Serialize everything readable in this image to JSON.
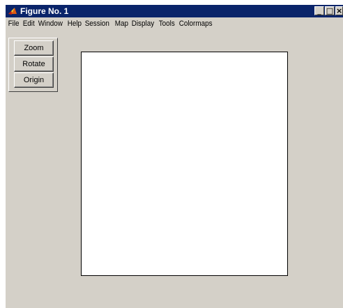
{
  "window": {
    "title": "Figure No. 1",
    "controls": [
      "_",
      "□",
      "×"
    ]
  },
  "menu": [
    {
      "label": "File"
    },
    {
      "label": "Edit"
    },
    {
      "label": "Window"
    },
    {
      "label": "Help"
    },
    {
      "label": "Session"
    },
    {
      "label": "Map"
    },
    {
      "label": "Display"
    },
    {
      "label": "Tools"
    },
    {
      "label": "Colormaps"
    }
  ],
  "toolbar": {
    "zoom_label": "Zoom",
    "rotate_label": "Rotate",
    "origin_label": "Origin"
  },
  "colors": {
    "titlebar": "#0a246a",
    "background": "#d4d0c8",
    "axes": "#ffffff"
  },
  "icons": {
    "app": "matlab-logo-icon"
  }
}
